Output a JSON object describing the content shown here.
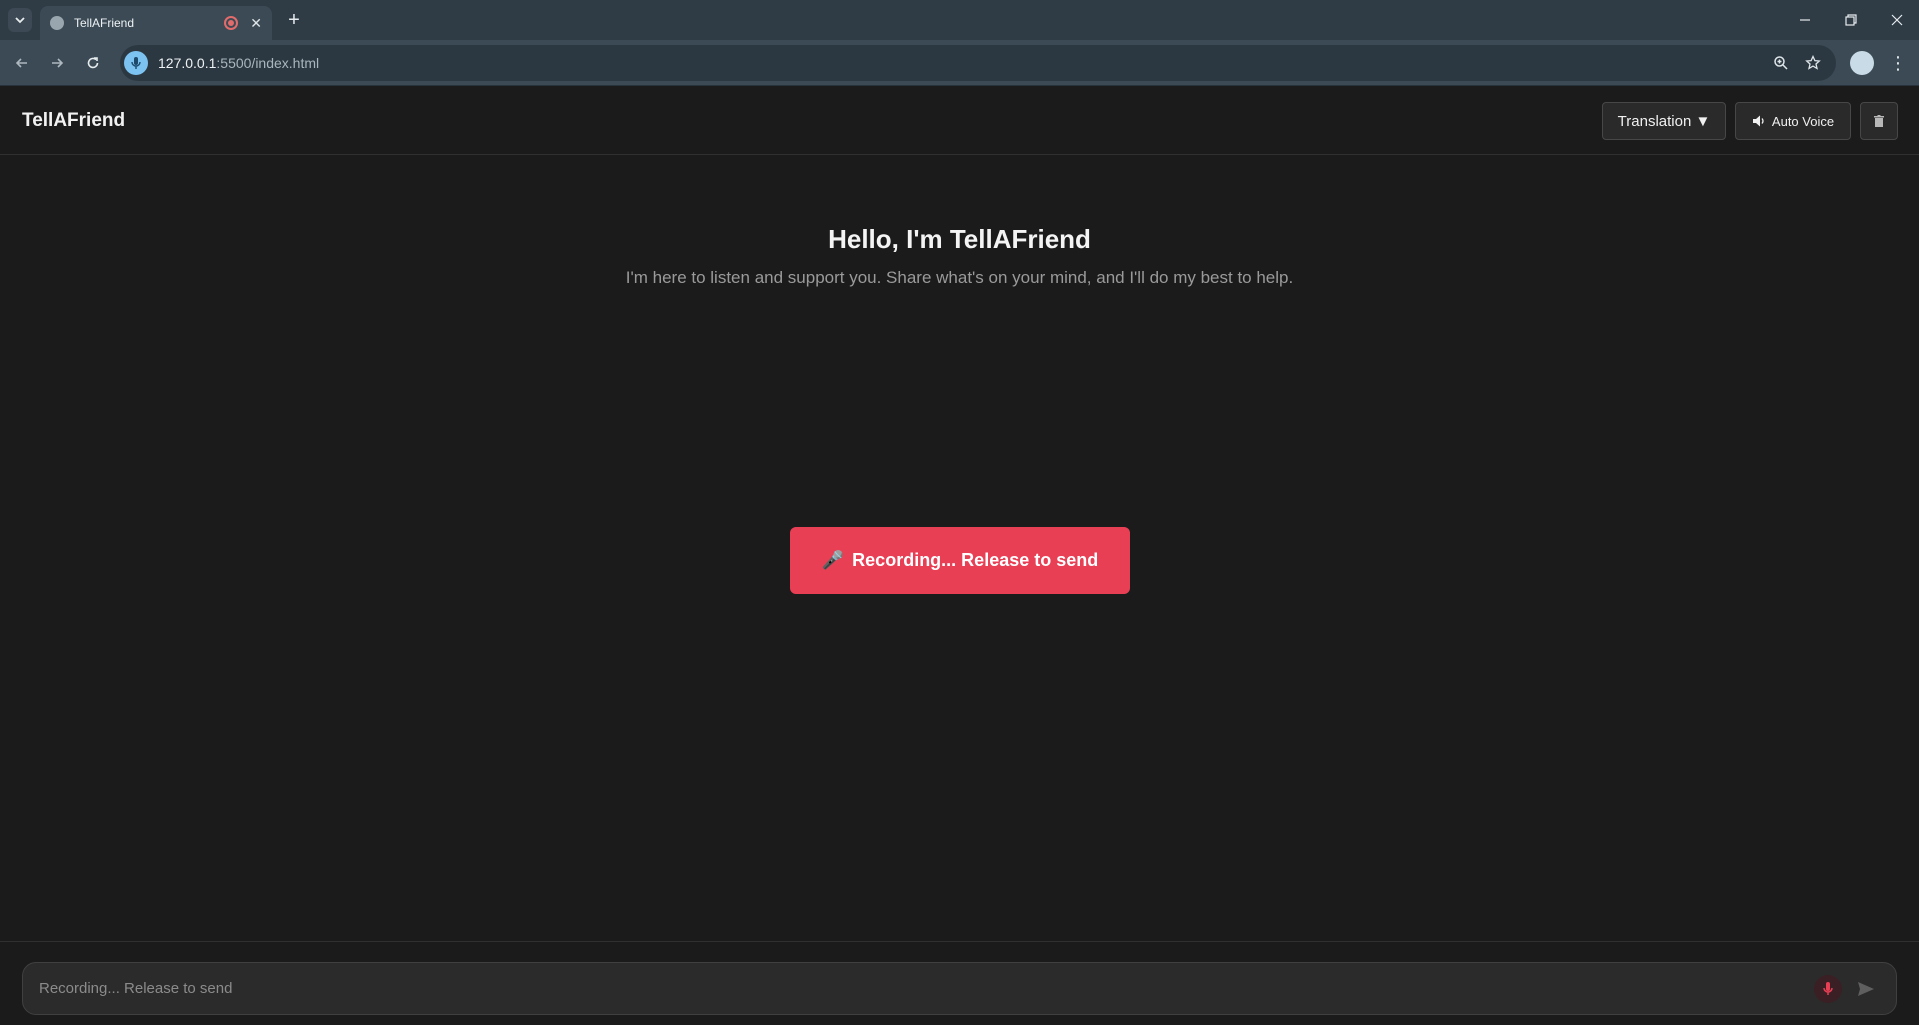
{
  "browser": {
    "tab_title": "TellAFriend",
    "url_host": "127.0.0.1",
    "url_rest": ":5500/index.html",
    "new_tab_symbol": "+",
    "close_symbol": "✕"
  },
  "header": {
    "brand": "TellAFriend",
    "translation_label": "Translation ▼",
    "auto_voice_label": "Auto Voice",
    "trash_icon": "trash-icon"
  },
  "hero": {
    "title": "Hello, I'm TellAFriend",
    "subtitle": "I'm here to listen and support you. Share what's on your mind, and I'll do my best to help."
  },
  "record_button": {
    "icon": "🎤",
    "label": "Recording... Release to send",
    "color": "#e83f55"
  },
  "composer": {
    "placeholder": "Recording... Release to send"
  }
}
